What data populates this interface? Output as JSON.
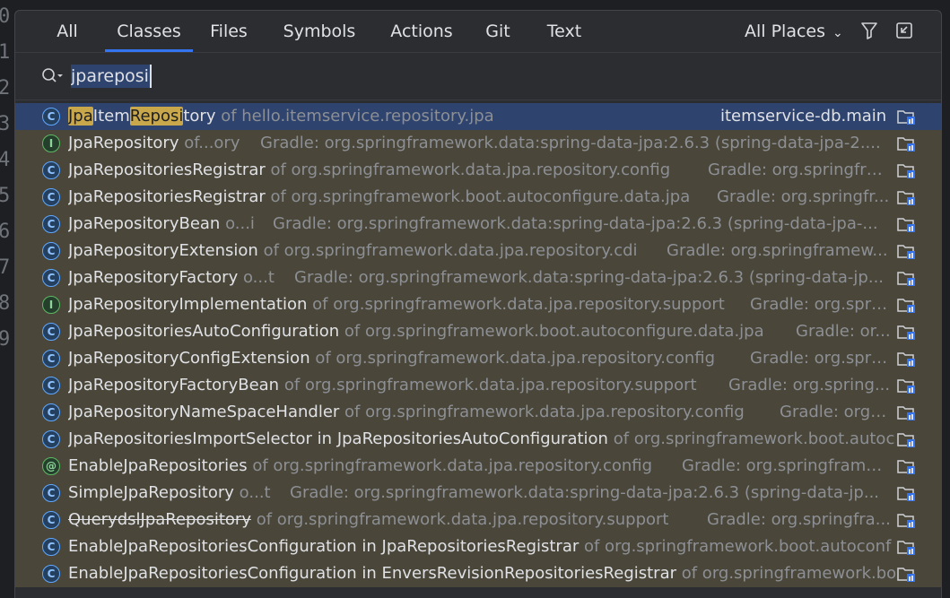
{
  "gutter_numbers": [
    "0",
    "1",
    "2",
    "3",
    "4",
    "5",
    "6",
    "7",
    "8",
    "9"
  ],
  "tabs": [
    {
      "label": "All"
    },
    {
      "label": "Classes"
    },
    {
      "label": "Files"
    },
    {
      "label": "Symbols"
    },
    {
      "label": "Actions"
    },
    {
      "label": "Git"
    },
    {
      "label": "Text"
    }
  ],
  "active_tab": "Classes",
  "places": {
    "label": "All Places"
  },
  "search": {
    "value": "jpareposi",
    "placeholder": ""
  },
  "results": [
    {
      "kind": "c",
      "name_hl": [
        [
          "Jpa",
          true
        ],
        [
          "Item",
          false
        ],
        [
          "Reposi",
          true
        ],
        [
          "tory",
          false
        ]
      ],
      "pkg": " of hello.itemservice.repository.jpa",
      "loc": "itemservice-db.main",
      "selected": true
    },
    {
      "kind": "i",
      "name": "JpaRepository",
      "pkg": " of...ory",
      "loc": "Gradle: org.springframework.data:spring-data-jpa:2.6.3 (spring-data-jpa-2...."
    },
    {
      "kind": "c",
      "name": "JpaRepositoriesRegistrar",
      "pkg": " of org.springframework.data.jpa.repository.config",
      "loc": "Gradle: org.springfra..."
    },
    {
      "kind": "c",
      "name": "JpaRepositoriesRegistrar",
      "pkg": " of org.springframework.boot.autoconfigure.data.jpa",
      "loc": "Gradle: org.springfr..."
    },
    {
      "kind": "c",
      "name": "JpaRepositoryBean",
      "pkg": " o...i",
      "loc": "Gradle: org.springframework.data:spring-data-jpa:2.6.3 (spring-data-jpa-..."
    },
    {
      "kind": "c",
      "name": "JpaRepositoryExtension",
      "pkg": " of org.springframework.data.jpa.repository.cdi",
      "loc": "Gradle: org.springframew..."
    },
    {
      "kind": "c",
      "name": "JpaRepositoryFactory",
      "pkg": " o...t",
      "loc": "Gradle: org.springframework.data:spring-data-jpa:2.6.3 (spring-data-jp..."
    },
    {
      "kind": "i",
      "name": "JpaRepositoryImplementation",
      "pkg": " of org.springframework.data.jpa.repository.support",
      "loc": "Gradle: org.spri..."
    },
    {
      "kind": "c",
      "name": "JpaRepositoriesAutoConfiguration",
      "pkg": " of org.springframework.boot.autoconfigure.data.jpa",
      "loc": "Gradle: or..."
    },
    {
      "kind": "c",
      "name": "JpaRepositoryConfigExtension",
      "pkg": " of org.springframework.data.jpa.repository.config",
      "loc": "Gradle: org.spri..."
    },
    {
      "kind": "c",
      "name": "JpaRepositoryFactoryBean",
      "pkg": " of org.springframework.data.jpa.repository.support",
      "loc": "Gradle: org.spring..."
    },
    {
      "kind": "c",
      "name": "JpaRepositoryNameSpaceHandler",
      "pkg": " of org.springframework.data.jpa.repository.config",
      "loc": "Gradle: org...."
    },
    {
      "kind": "c",
      "name": "JpaRepositoriesImportSelector in JpaRepositoriesAutoConfiguration",
      "pkg": " of org.springframework.boot.autoc",
      "loc": ""
    },
    {
      "kind": "a",
      "name": "EnableJpaRepositories",
      "pkg": " of org.springframework.data.jpa.repository.config",
      "loc": "Gradle: org.springframe..."
    },
    {
      "kind": "c",
      "name": "SimpleJpaRepository",
      "pkg": " o...t",
      "loc": "Gradle: org.springframework.data:spring-data-jpa:2.6.3 (spring-data-jp..."
    },
    {
      "kind": "c",
      "name": "QuerydslJpaRepository",
      "pkg": " of org.springframework.data.jpa.repository.support",
      "loc": "Gradle: org.springfra...",
      "deprecated": true
    },
    {
      "kind": "c",
      "name": "EnableJpaRepositoriesConfiguration in JpaRepositoriesRegistrar",
      "pkg": " of org.springframework.boot.autoconf",
      "loc": ""
    },
    {
      "kind": "c",
      "name": "EnableJpaRepositoriesConfiguration in EnversRevisionRepositoriesRegistrar",
      "pkg": " of org.springframework.bo",
      "loc": ""
    }
  ],
  "colors": {
    "accent": "#3574f0",
    "selected_row": "#2e436e",
    "match_row": "#4a4639",
    "highlight": "#c9a84c"
  }
}
